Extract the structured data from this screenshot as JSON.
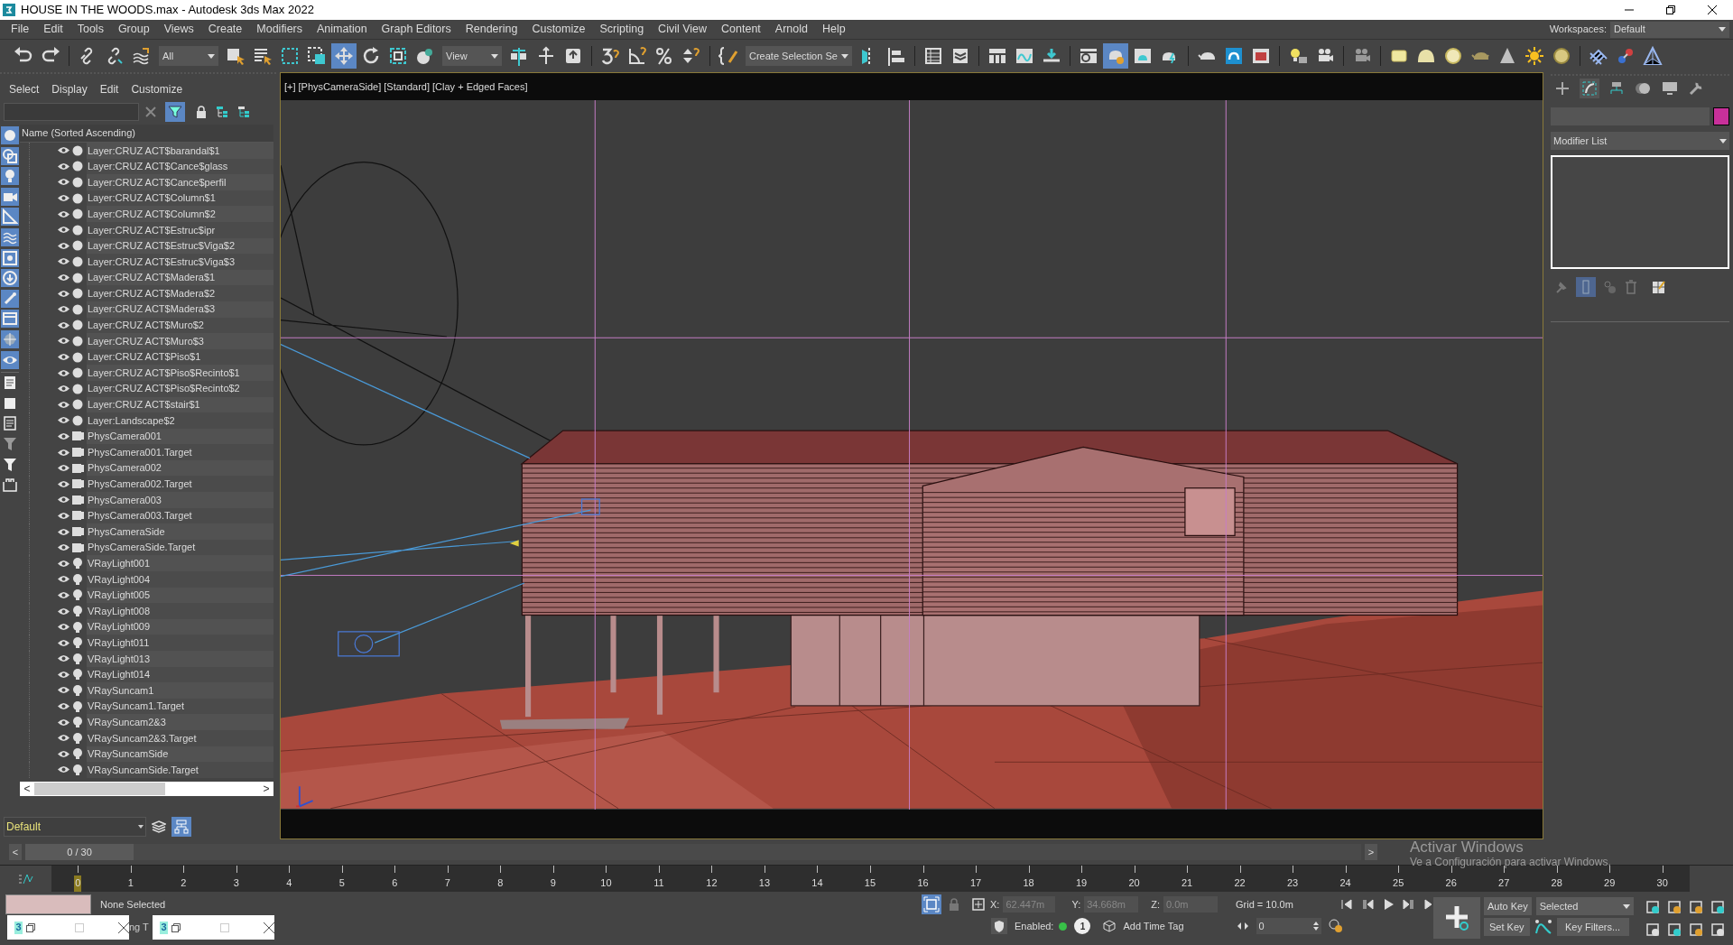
{
  "window": {
    "title": "HOUSE IN THE WOODS.max - Autodesk 3ds Max 2022"
  },
  "menu": [
    "File",
    "Edit",
    "Tools",
    "Group",
    "Views",
    "Create",
    "Modifiers",
    "Animation",
    "Graph Editors",
    "Rendering",
    "Customize",
    "Scripting",
    "Civil View",
    "Content",
    "Arnold",
    "Help"
  ],
  "workspaces": {
    "label": "Workspaces:",
    "value": "Default"
  },
  "toolbar": {
    "selection_filter": "All",
    "reference_coordinate": "View",
    "named_selection": "Create Selection Se"
  },
  "explorer": {
    "menu": [
      "Select",
      "Display",
      "Edit",
      "Customize"
    ],
    "column": "Name (Sorted Ascending)",
    "rows": [
      {
        "name": "Layer:CRUZ ACT$barandal$1",
        "kind": "layer"
      },
      {
        "name": "Layer:CRUZ ACT$Cance$glass",
        "kind": "layer"
      },
      {
        "name": "Layer:CRUZ ACT$Cance$perfil",
        "kind": "layer"
      },
      {
        "name": "Layer:CRUZ ACT$Column$1",
        "kind": "layer"
      },
      {
        "name": "Layer:CRUZ ACT$Column$2",
        "kind": "layer"
      },
      {
        "name": "Layer:CRUZ ACT$Estruc$ipr",
        "kind": "layer"
      },
      {
        "name": "Layer:CRUZ ACT$Estruc$Viga$2",
        "kind": "layer"
      },
      {
        "name": "Layer:CRUZ ACT$Estruc$Viga$3",
        "kind": "layer"
      },
      {
        "name": "Layer:CRUZ ACT$Madera$1",
        "kind": "layer"
      },
      {
        "name": "Layer:CRUZ ACT$Madera$2",
        "kind": "layer"
      },
      {
        "name": "Layer:CRUZ ACT$Madera$3",
        "kind": "layer"
      },
      {
        "name": "Layer:CRUZ ACT$Muro$2",
        "kind": "layer"
      },
      {
        "name": "Layer:CRUZ ACT$Muro$3",
        "kind": "layer"
      },
      {
        "name": "Layer:CRUZ ACT$Piso$1",
        "kind": "layer"
      },
      {
        "name": "Layer:CRUZ ACT$Piso$Recinto$1",
        "kind": "layer"
      },
      {
        "name": "Layer:CRUZ ACT$Piso$Recinto$2",
        "kind": "layer"
      },
      {
        "name": "Layer:CRUZ ACT$stair$1",
        "kind": "layer"
      },
      {
        "name": "Layer:Landscape$2",
        "kind": "layer"
      },
      {
        "name": "PhysCamera001",
        "kind": "camera"
      },
      {
        "name": "PhysCamera001.Target",
        "kind": "camera"
      },
      {
        "name": "PhysCamera002",
        "kind": "camera"
      },
      {
        "name": "PhysCamera002.Target",
        "kind": "camera"
      },
      {
        "name": "PhysCamera003",
        "kind": "camera"
      },
      {
        "name": "PhysCamera003.Target",
        "kind": "camera"
      },
      {
        "name": "PhysCameraSide",
        "kind": "camera"
      },
      {
        "name": "PhysCameraSide.Target",
        "kind": "camera"
      },
      {
        "name": "VRayLight001",
        "kind": "light"
      },
      {
        "name": "VRayLight004",
        "kind": "light"
      },
      {
        "name": "VRayLight005",
        "kind": "light"
      },
      {
        "name": "VRayLight008",
        "kind": "light"
      },
      {
        "name": "VRayLight009",
        "kind": "light"
      },
      {
        "name": "VRayLight011",
        "kind": "light"
      },
      {
        "name": "VRayLight013",
        "kind": "light"
      },
      {
        "name": "VRayLight014",
        "kind": "light"
      },
      {
        "name": "VRaySuncam1",
        "kind": "light"
      },
      {
        "name": "VRaySuncam1.Target",
        "kind": "light"
      },
      {
        "name": "VRaySuncam2&3",
        "kind": "light"
      },
      {
        "name": "VRaySuncam2&3.Target",
        "kind": "light"
      },
      {
        "name": "VRaySuncamSide",
        "kind": "light"
      },
      {
        "name": "VRaySuncamSide.Target",
        "kind": "light"
      }
    ],
    "scroll_left": "<",
    "scroll_right": ">",
    "layer": "Default"
  },
  "viewport": {
    "labels": [
      "[+]",
      "[PhysCameraSide]",
      "[Standard]",
      "[Clay + Edged Faces]"
    ]
  },
  "command_panel": {
    "modifier_list": "Modifier List"
  },
  "time_slider": {
    "prev": "<",
    "position": "0 / 30",
    "level": 0,
    "next": ">"
  },
  "activation": {
    "title": "Activar Windows",
    "hint": "Ve a Configuración para activar Windows."
  },
  "ruler": [
    "0",
    "1",
    "2",
    "3",
    "4",
    "5",
    "6",
    "7",
    "8",
    "9",
    "10",
    "11",
    "12",
    "13",
    "14",
    "15",
    "16",
    "17",
    "18",
    "19",
    "20",
    "21",
    "22",
    "23",
    "24",
    "25",
    "26",
    "27",
    "28",
    "29",
    "30"
  ],
  "status": {
    "selection": "None Selected",
    "x_label": "X:",
    "x": "62.447m",
    "y_label": "Y:",
    "y": "34.668m",
    "z_label": "Z:",
    "z": "0.0m",
    "grid": "Grid = 10.0m",
    "enabled_label": "Enabled:",
    "enabled_count": "1",
    "add_time_tag": "Add Time Tag",
    "frame": "0",
    "auto_key": "Auto Key",
    "key_mode": "Selected",
    "set_key": "Set Key",
    "key_filters": "Key Filters..."
  },
  "taskbar_previews": [
    {
      "icon": "3"
    },
    {
      "icon": "3"
    }
  ],
  "taskbar_text": "ng T"
}
